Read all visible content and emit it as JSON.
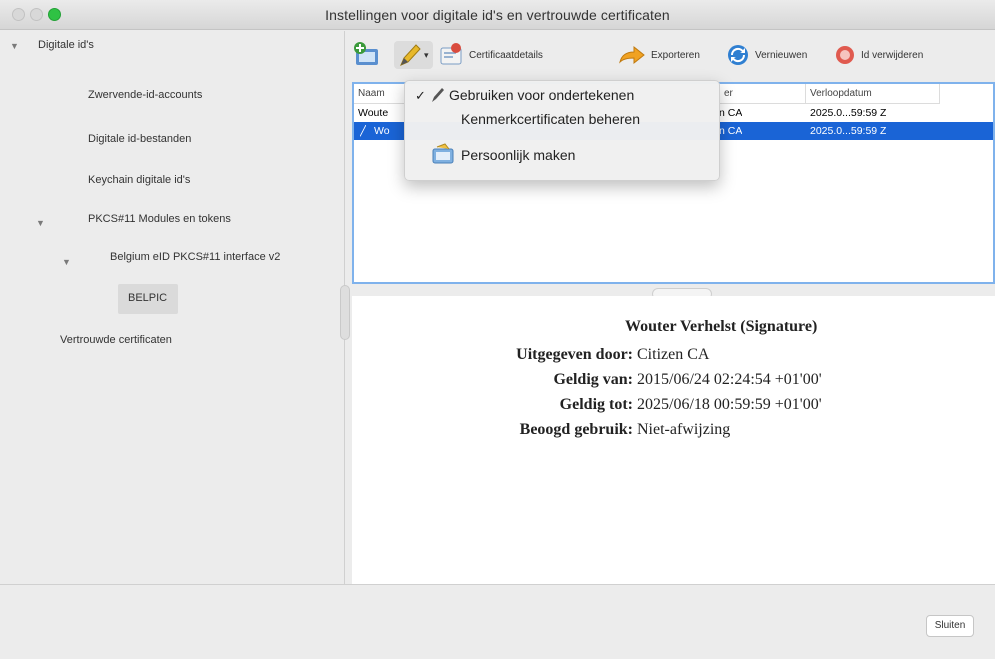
{
  "window": {
    "title": "Instellingen voor digitale id's en vertrouwde certificaten"
  },
  "sidebar": {
    "items": [
      {
        "label": "Digitale id's"
      },
      {
        "label": "Zwervende-id-accounts"
      },
      {
        "label": "Digitale id-bestanden"
      },
      {
        "label": "Keychain digitale id's"
      },
      {
        "label": "PKCS#11 Modules en tokens"
      },
      {
        "label": "Belgium eID PKCS#11 interface v2"
      },
      {
        "label": "BELPIC"
      },
      {
        "label": "Vertrouwde certificaten"
      }
    ]
  },
  "toolbar": {
    "details_label": "Certificaatdetails",
    "export_label": "Exporteren",
    "refresh_label": "Vernieuwen",
    "remove_label": "Id verwijderen"
  },
  "table": {
    "headers": [
      "Naam",
      "",
      "er",
      "Verloopdatum"
    ],
    "rows": [
      {
        "name": "Woute",
        "issuer": "n CA",
        "expiry": "2025.0...59:59 Z"
      },
      {
        "name": "Wo",
        "issuer": "n CA",
        "expiry": "2025.0...59:59 Z"
      }
    ]
  },
  "menu": {
    "items": [
      {
        "label": "Gebruiken voor ondertekenen",
        "checked": true
      },
      {
        "label": "Kenmerkcertificaten beheren"
      },
      {
        "label": "Persoonlijk maken"
      }
    ]
  },
  "details": {
    "name": "Wouter Verhelst (Signature)",
    "issued_by_label": "Uitgegeven door:",
    "issued_by": "Citizen CA",
    "valid_from_label": "Geldig van:",
    "valid_from": "2015/06/24 02:24:54 +01'00'",
    "valid_to_label": "Geldig tot:",
    "valid_to": "2025/06/18 00:59:59 +01'00'",
    "usage_label": "Beoogd gebruik:",
    "usage": "Niet-afwijzing"
  },
  "footer": {
    "close_label": "Sluiten"
  },
  "colors": {
    "selection": "#1a64d6",
    "table_focus_border": "#7fb2ec",
    "maximize_green": "#2fc244"
  }
}
